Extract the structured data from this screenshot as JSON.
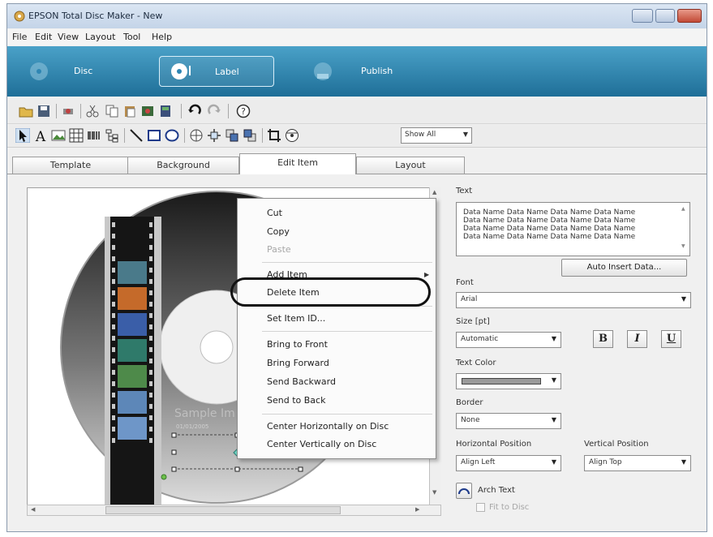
{
  "window": {
    "title": "EPSON Total Disc Maker - New"
  },
  "menubar": [
    "File",
    "Edit",
    "View",
    "Layout",
    "Tool",
    "Help"
  ],
  "nav": [
    {
      "label": "Disc",
      "icon": "disc-icon",
      "selected": false
    },
    {
      "label": "Label",
      "icon": "label-icon",
      "selected": true
    },
    {
      "label": "Publish",
      "icon": "publish-icon",
      "selected": false
    }
  ],
  "toolbar": {
    "show_select": "Show All"
  },
  "tabs": [
    "Template",
    "Background",
    "Edit Item",
    "Layout"
  ],
  "active_tab": "Edit Item",
  "canvas": {
    "sample_text": "Sample Im",
    "sample_date": "01/01/2005"
  },
  "context_menu": {
    "group1": [
      "Cut",
      "Copy",
      "Paste"
    ],
    "group2": [
      "Add Item",
      "Delete Item"
    ],
    "group3": [
      "Set Item ID..."
    ],
    "group4": [
      "Bring to Front",
      "Bring Forward",
      "Send Backward",
      "Send to Back"
    ],
    "group5": [
      "Center Horizontally on Disc",
      "Center Vertically on Disc"
    ]
  },
  "panel": {
    "text_label": "Text",
    "text_lines": [
      "Data Name Data Name Data Name Data Name",
      "Data Name Data Name Data Name Data Name",
      "Data Name Data Name Data Name Data Name",
      "Data Name Data Name Data Name Data Name"
    ],
    "auto_insert": "Auto Insert Data...",
    "font_label": "Font",
    "font_value": "Arial",
    "size_label": "Size [pt]",
    "size_value": "Automatic",
    "bold": "B",
    "italic": "I",
    "underline": "U",
    "text_color_label": "Text Color",
    "border_label": "Border",
    "border_value": "None",
    "hpos_label": "Horizontal Position",
    "hpos_value": "Align Left",
    "vpos_label": "Vertical Position",
    "vpos_value": "Align Top",
    "arch_text": "Arch Text",
    "fit_to_disc": "Fit to Disc"
  },
  "colors": {
    "nav_band": "#2f86b3",
    "text_color_swatch": "#9a9a9a"
  }
}
